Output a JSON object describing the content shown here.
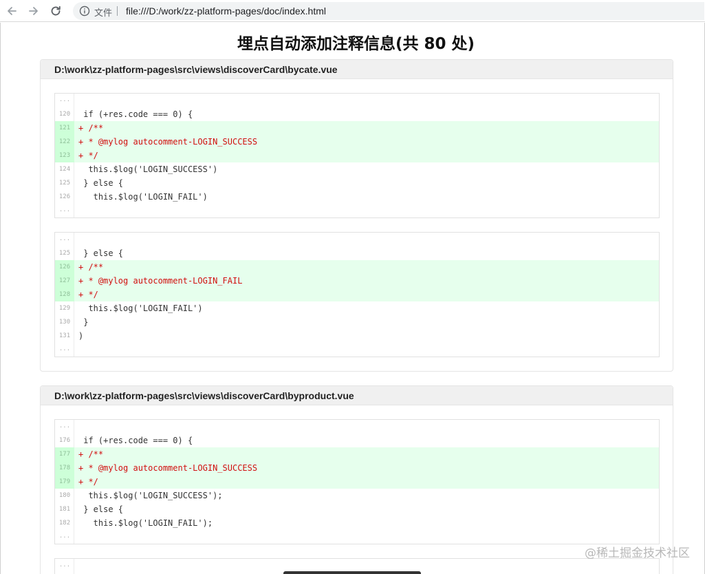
{
  "browser": {
    "scheme_label": "文件",
    "url": "file:///D:/work/zz-platform-pages/doc/index.html"
  },
  "page": {
    "title": "埋点自动添加注释信息(共 80 处)"
  },
  "files": [
    {
      "path": "D:\\work\\zz-platform-pages\\src\\views\\discoverCard\\bycate.vue",
      "hunks": [
        {
          "lines": [
            {
              "type": "ellipsis",
              "num": "...",
              "code": ""
            },
            {
              "type": "context",
              "num": "120",
              "code": " if (+res.code === 0) {"
            },
            {
              "type": "added",
              "num": "121",
              "code": "+ /**"
            },
            {
              "type": "added",
              "num": "122",
              "code": "+ * @mylog autocomment-LOGIN_SUCCESS"
            },
            {
              "type": "added",
              "num": "123",
              "code": "+ */"
            },
            {
              "type": "context",
              "num": "124",
              "code": "  this.$log('LOGIN_SUCCESS')"
            },
            {
              "type": "context",
              "num": "125",
              "code": " } else {"
            },
            {
              "type": "context",
              "num": "126",
              "code": "   this.$log('LOGIN_FAIL')"
            },
            {
              "type": "ellipsis",
              "num": "...",
              "code": ""
            }
          ]
        },
        {
          "lines": [
            {
              "type": "ellipsis",
              "num": "...",
              "code": ""
            },
            {
              "type": "context",
              "num": "125",
              "code": " } else {"
            },
            {
              "type": "added",
              "num": "126",
              "code": "+ /**"
            },
            {
              "type": "added",
              "num": "127",
              "code": "+ * @mylog autocomment-LOGIN_FAIL"
            },
            {
              "type": "added",
              "num": "128",
              "code": "+ */"
            },
            {
              "type": "context",
              "num": "129",
              "code": "  this.$log('LOGIN_FAIL')"
            },
            {
              "type": "context",
              "num": "130",
              "code": " }"
            },
            {
              "type": "context",
              "num": "131",
              "code": ")"
            },
            {
              "type": "ellipsis",
              "num": "...",
              "code": ""
            }
          ]
        }
      ]
    },
    {
      "path": "D:\\work\\zz-platform-pages\\src\\views\\discoverCard\\byproduct.vue",
      "hunks": [
        {
          "lines": [
            {
              "type": "ellipsis",
              "num": "...",
              "code": ""
            },
            {
              "type": "context",
              "num": "176",
              "code": " if (+res.code === 0) {"
            },
            {
              "type": "added",
              "num": "177",
              "code": "+ /**"
            },
            {
              "type": "added",
              "num": "178",
              "code": "+ * @mylog autocomment-LOGIN_SUCCESS"
            },
            {
              "type": "added",
              "num": "179",
              "code": "+ */"
            },
            {
              "type": "context",
              "num": "180",
              "code": "  this.$log('LOGIN_SUCCESS');"
            },
            {
              "type": "context",
              "num": "181",
              "code": " } else {"
            },
            {
              "type": "context",
              "num": "182",
              "code": "   this.$log('LOGIN_FAIL');"
            },
            {
              "type": "ellipsis",
              "num": "...",
              "code": ""
            }
          ]
        },
        {
          "lines": [
            {
              "type": "ellipsis",
              "num": "...",
              "code": ""
            }
          ]
        }
      ]
    }
  ],
  "watermark": "@稀土掘金技术社区",
  "icons": {
    "back": "arrow-left-icon",
    "forward": "arrow-right-icon",
    "reload": "reload-icon",
    "info": "info-icon"
  }
}
